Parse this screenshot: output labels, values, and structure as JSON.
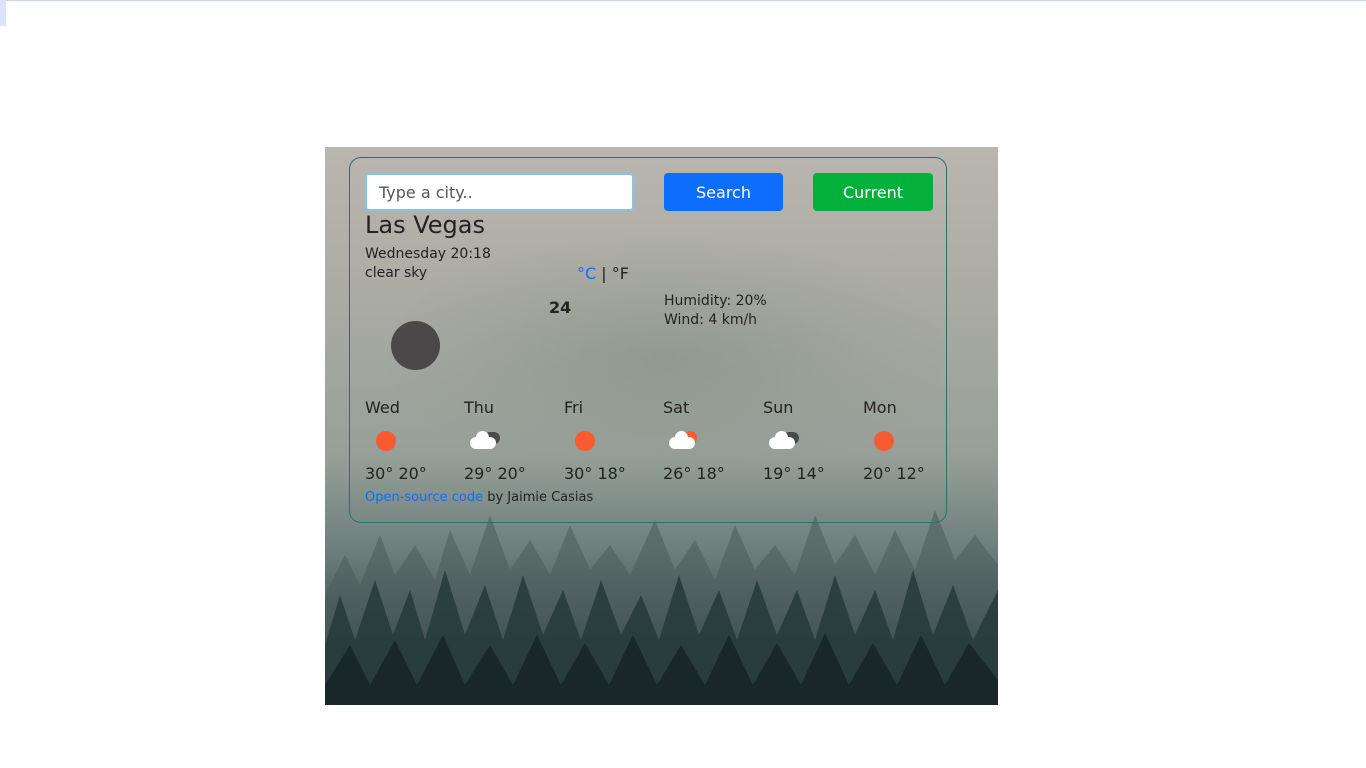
{
  "search": {
    "placeholder": "Type a city..",
    "search_label": "Search",
    "current_label": "Current"
  },
  "weather": {
    "city": "Las Vegas",
    "datetime": "Wednesday 20:18",
    "description": "clear sky",
    "unit_celsius": "°C",
    "unit_separator": "|",
    "unit_fahrenheit": "°F",
    "temperature": "24",
    "humidity": "Humidity: 20%",
    "wind": "Wind: 4 km/h",
    "icon": "moon-icon"
  },
  "forecast": [
    {
      "day": "Wed",
      "icon": "sun-icon",
      "temps": "30° 20°"
    },
    {
      "day": "Thu",
      "icon": "broken-clouds-icon",
      "temps": "29° 20°"
    },
    {
      "day": "Fri",
      "icon": "sun-icon",
      "temps": "30° 18°"
    },
    {
      "day": "Sat",
      "icon": "few-clouds-icon",
      "temps": "26° 18°"
    },
    {
      "day": "Sun",
      "icon": "broken-clouds-icon",
      "temps": "19° 14°"
    },
    {
      "day": "Mon",
      "icon": "sun-icon",
      "temps": "20° 12°"
    }
  ],
  "footer": {
    "link_text": "Open-source code",
    "author_text": " by Jaimie Casias"
  },
  "colors": {
    "primary_button": "#0d6efd",
    "current_button": "#03b03c",
    "sun": "#fa5a2f",
    "moon": "#4a4848"
  }
}
